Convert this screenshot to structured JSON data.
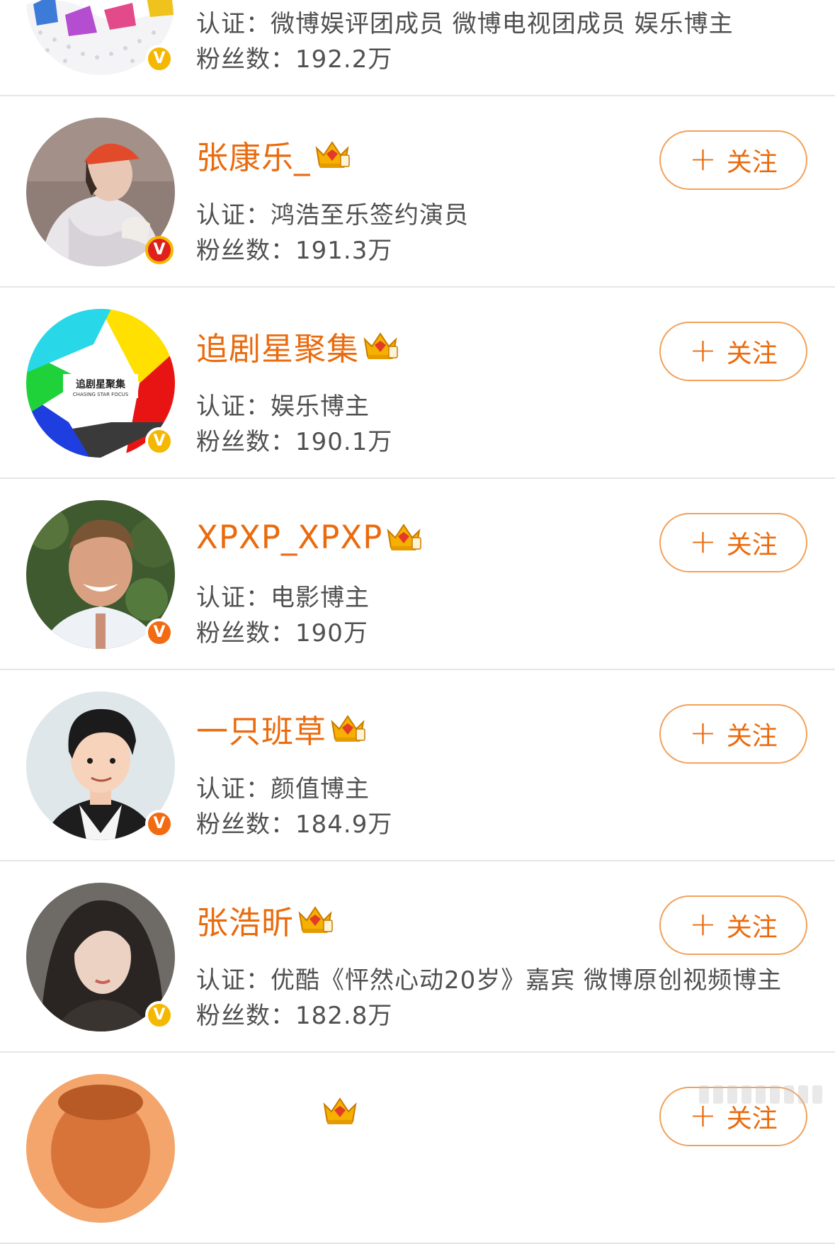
{
  "colors": {
    "accent": "#ea6b0e",
    "badge_gold": "#f5b800",
    "badge_orange": "#f36a10",
    "badge_red": "#e0201b"
  },
  "follow_label": "关注",
  "follow_plus": "+",
  "users": [
    {
      "name": "",
      "cert_label": "认证：",
      "cert": "微博娱评团成员 微博电视团成员 娱乐博主",
      "fans_label": "粉丝数：",
      "fans": "192.2万",
      "badge": "gold",
      "badge_text": "V",
      "crown": false,
      "follow": false,
      "avatar_icon": "cartoon-logo-avatar-icon"
    },
    {
      "name": "张康乐_",
      "cert_label": "认证：",
      "cert": "鸿浩至乐签约演员",
      "fans_label": "粉丝数：",
      "fans": "191.3万",
      "badge": "red",
      "badge_text": "V",
      "crown": true,
      "follow": true,
      "avatar_icon": "person-hoodie-avatar-icon"
    },
    {
      "name": "追剧星聚集",
      "cert_label": "认证：",
      "cert": "娱乐博主",
      "fans_label": "粉丝数：",
      "fans": "190.1万",
      "badge": "gold",
      "badge_text": "V",
      "crown": true,
      "follow": true,
      "avatar_icon": "aperture-logo-avatar-icon",
      "logo_text": "追剧星聚集",
      "logo_sub": "CHASING STAR FOCUS"
    },
    {
      "name": "XPXP_XPXP",
      "cert_label": "认证：",
      "cert": "电影博主",
      "fans_label": "粉丝数：",
      "fans": "190万",
      "badge": "orange",
      "badge_text": "V",
      "crown": true,
      "follow": true,
      "avatar_icon": "smiling-man-avatar-icon"
    },
    {
      "name": "一只班草",
      "cert_label": "认证：",
      "cert": "颜值博主",
      "fans_label": "粉丝数：",
      "fans": "184.9万",
      "badge": "orange",
      "badge_text": "V",
      "crown": true,
      "follow": true,
      "avatar_icon": "cartoon-boy-avatar-icon"
    },
    {
      "name": "张浩昕",
      "cert_label": "认证：",
      "cert": "优酷《怦然心动20岁》嘉宾 微博原创视频博主",
      "fans_label": "粉丝数：",
      "fans": "182.8万",
      "badge": "gold",
      "badge_text": "V",
      "crown": true,
      "follow": true,
      "avatar_icon": "woman-portrait-avatar-icon"
    },
    {
      "name": "",
      "cert_label": "",
      "cert": "",
      "fans_label": "",
      "fans": "",
      "badge": "",
      "badge_text": "",
      "crown": true,
      "follow": true,
      "avatar_icon": "partial-avatar-icon"
    }
  ]
}
